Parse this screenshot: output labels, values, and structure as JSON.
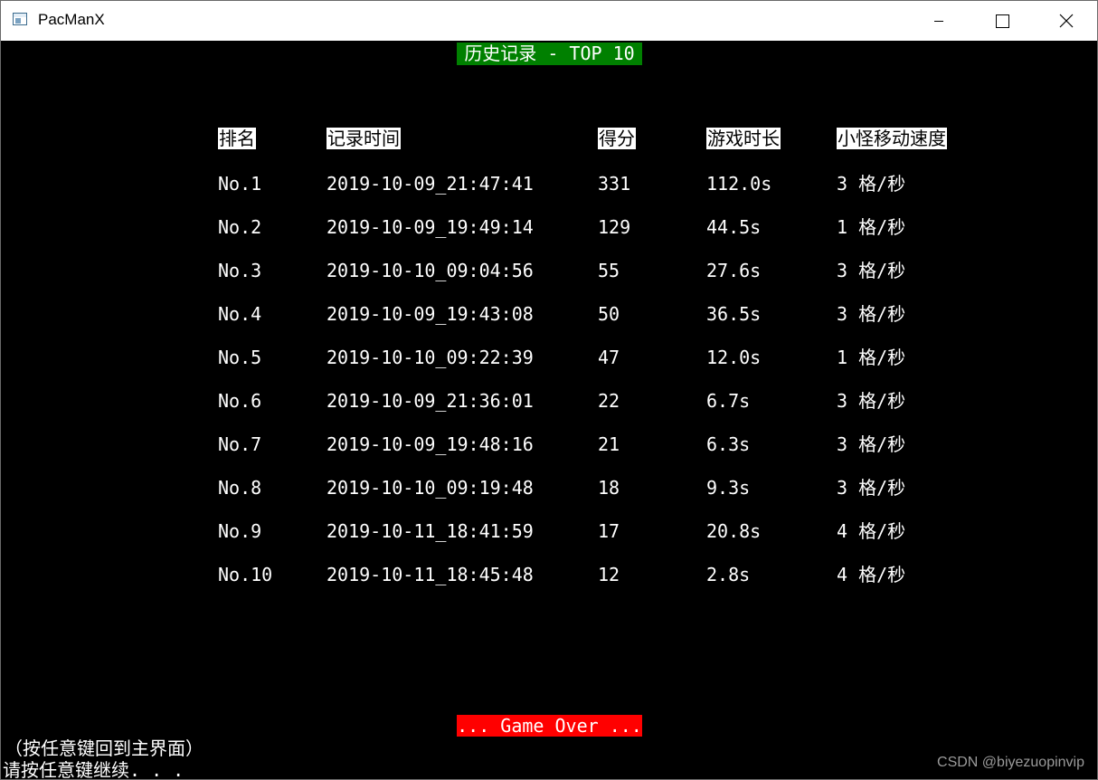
{
  "window": {
    "title": "PacManX"
  },
  "screen": {
    "title": "历史记录 - TOP 10",
    "headers": {
      "rank": "排名",
      "time": "记录时间",
      "score": "得分",
      "duration": "游戏时长",
      "speed": "小怪移动速度"
    },
    "rows": [
      {
        "rank": "No.1",
        "time": "2019-10-09_21:47:41",
        "score": "331",
        "duration": "112.0s",
        "speed": "3 格/秒"
      },
      {
        "rank": "No.2",
        "time": "2019-10-09_19:49:14",
        "score": "129",
        "duration": "44.5s",
        "speed": "1 格/秒"
      },
      {
        "rank": "No.3",
        "time": "2019-10-10_09:04:56",
        "score": "55",
        "duration": "27.6s",
        "speed": "3 格/秒"
      },
      {
        "rank": "No.4",
        "time": "2019-10-09_19:43:08",
        "score": "50",
        "duration": "36.5s",
        "speed": "3 格/秒"
      },
      {
        "rank": "No.5",
        "time": "2019-10-10_09:22:39",
        "score": "47",
        "duration": "12.0s",
        "speed": "1 格/秒"
      },
      {
        "rank": "No.6",
        "time": "2019-10-09_21:36:01",
        "score": "22",
        "duration": "6.7s",
        "speed": "3 格/秒"
      },
      {
        "rank": "No.7",
        "time": "2019-10-09_19:48:16",
        "score": "21",
        "duration": "6.3s",
        "speed": "3 格/秒"
      },
      {
        "rank": "No.8",
        "time": "2019-10-10_09:19:48",
        "score": "18",
        "duration": "9.3s",
        "speed": "3 格/秒"
      },
      {
        "rank": "No.9",
        "time": "2019-10-11_18:41:59",
        "score": "17",
        "duration": "20.8s",
        "speed": "4 格/秒"
      },
      {
        "rank": "No.10",
        "time": "2019-10-11_18:45:48",
        "score": "12",
        "duration": "2.8s",
        "speed": "4 格/秒"
      }
    ],
    "game_over": "... Game Over ...",
    "hint_back": "（按任意键回到主界面）",
    "hint_continue": "请按任意键继续. . .",
    "watermark": "CSDN @biyezuopinvip"
  },
  "colors": {
    "title_bg": "#008000",
    "game_over_bg": "#ff0000",
    "console_bg": "#000000",
    "text": "#ffffff"
  },
  "icons": {
    "app": "console-app-icon",
    "minimize": "minimize-icon",
    "maximize": "maximize-icon",
    "close": "close-icon"
  }
}
